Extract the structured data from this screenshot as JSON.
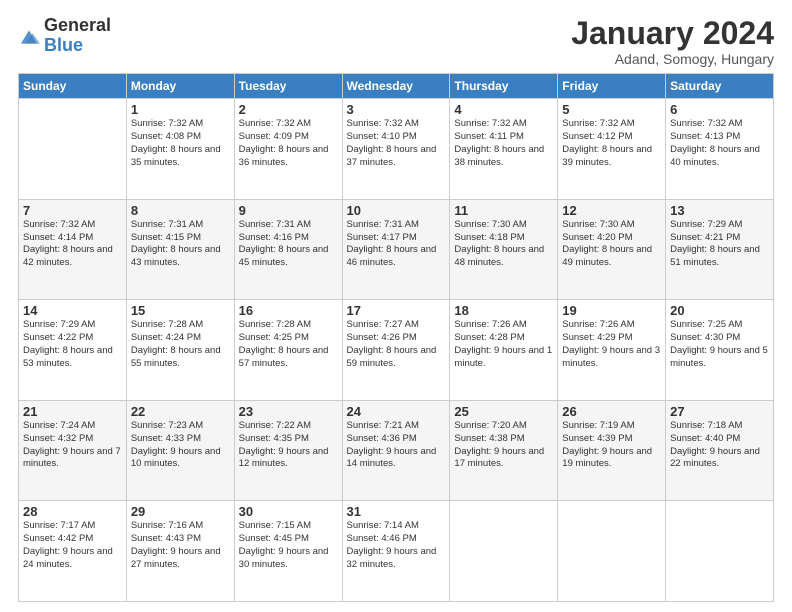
{
  "logo": {
    "general": "General",
    "blue": "Blue"
  },
  "title": "January 2024",
  "subtitle": "Adand, Somogy, Hungary",
  "days_header": [
    "Sunday",
    "Monday",
    "Tuesday",
    "Wednesday",
    "Thursday",
    "Friday",
    "Saturday"
  ],
  "weeks": [
    [
      {
        "day": "",
        "sunrise": "",
        "sunset": "",
        "daylight": ""
      },
      {
        "day": "1",
        "sunrise": "Sunrise: 7:32 AM",
        "sunset": "Sunset: 4:08 PM",
        "daylight": "Daylight: 8 hours and 35 minutes."
      },
      {
        "day": "2",
        "sunrise": "Sunrise: 7:32 AM",
        "sunset": "Sunset: 4:09 PM",
        "daylight": "Daylight: 8 hours and 36 minutes."
      },
      {
        "day": "3",
        "sunrise": "Sunrise: 7:32 AM",
        "sunset": "Sunset: 4:10 PM",
        "daylight": "Daylight: 8 hours and 37 minutes."
      },
      {
        "day": "4",
        "sunrise": "Sunrise: 7:32 AM",
        "sunset": "Sunset: 4:11 PM",
        "daylight": "Daylight: 8 hours and 38 minutes."
      },
      {
        "day": "5",
        "sunrise": "Sunrise: 7:32 AM",
        "sunset": "Sunset: 4:12 PM",
        "daylight": "Daylight: 8 hours and 39 minutes."
      },
      {
        "day": "6",
        "sunrise": "Sunrise: 7:32 AM",
        "sunset": "Sunset: 4:13 PM",
        "daylight": "Daylight: 8 hours and 40 minutes."
      }
    ],
    [
      {
        "day": "7",
        "sunrise": "Sunrise: 7:32 AM",
        "sunset": "Sunset: 4:14 PM",
        "daylight": "Daylight: 8 hours and 42 minutes."
      },
      {
        "day": "8",
        "sunrise": "Sunrise: 7:31 AM",
        "sunset": "Sunset: 4:15 PM",
        "daylight": "Daylight: 8 hours and 43 minutes."
      },
      {
        "day": "9",
        "sunrise": "Sunrise: 7:31 AM",
        "sunset": "Sunset: 4:16 PM",
        "daylight": "Daylight: 8 hours and 45 minutes."
      },
      {
        "day": "10",
        "sunrise": "Sunrise: 7:31 AM",
        "sunset": "Sunset: 4:17 PM",
        "daylight": "Daylight: 8 hours and 46 minutes."
      },
      {
        "day": "11",
        "sunrise": "Sunrise: 7:30 AM",
        "sunset": "Sunset: 4:18 PM",
        "daylight": "Daylight: 8 hours and 48 minutes."
      },
      {
        "day": "12",
        "sunrise": "Sunrise: 7:30 AM",
        "sunset": "Sunset: 4:20 PM",
        "daylight": "Daylight: 8 hours and 49 minutes."
      },
      {
        "day": "13",
        "sunrise": "Sunrise: 7:29 AM",
        "sunset": "Sunset: 4:21 PM",
        "daylight": "Daylight: 8 hours and 51 minutes."
      }
    ],
    [
      {
        "day": "14",
        "sunrise": "Sunrise: 7:29 AM",
        "sunset": "Sunset: 4:22 PM",
        "daylight": "Daylight: 8 hours and 53 minutes."
      },
      {
        "day": "15",
        "sunrise": "Sunrise: 7:28 AM",
        "sunset": "Sunset: 4:24 PM",
        "daylight": "Daylight: 8 hours and 55 minutes."
      },
      {
        "day": "16",
        "sunrise": "Sunrise: 7:28 AM",
        "sunset": "Sunset: 4:25 PM",
        "daylight": "Daylight: 8 hours and 57 minutes."
      },
      {
        "day": "17",
        "sunrise": "Sunrise: 7:27 AM",
        "sunset": "Sunset: 4:26 PM",
        "daylight": "Daylight: 8 hours and 59 minutes."
      },
      {
        "day": "18",
        "sunrise": "Sunrise: 7:26 AM",
        "sunset": "Sunset: 4:28 PM",
        "daylight": "Daylight: 9 hours and 1 minute."
      },
      {
        "day": "19",
        "sunrise": "Sunrise: 7:26 AM",
        "sunset": "Sunset: 4:29 PM",
        "daylight": "Daylight: 9 hours and 3 minutes."
      },
      {
        "day": "20",
        "sunrise": "Sunrise: 7:25 AM",
        "sunset": "Sunset: 4:30 PM",
        "daylight": "Daylight: 9 hours and 5 minutes."
      }
    ],
    [
      {
        "day": "21",
        "sunrise": "Sunrise: 7:24 AM",
        "sunset": "Sunset: 4:32 PM",
        "daylight": "Daylight: 9 hours and 7 minutes."
      },
      {
        "day": "22",
        "sunrise": "Sunrise: 7:23 AM",
        "sunset": "Sunset: 4:33 PM",
        "daylight": "Daylight: 9 hours and 10 minutes."
      },
      {
        "day": "23",
        "sunrise": "Sunrise: 7:22 AM",
        "sunset": "Sunset: 4:35 PM",
        "daylight": "Daylight: 9 hours and 12 minutes."
      },
      {
        "day": "24",
        "sunrise": "Sunrise: 7:21 AM",
        "sunset": "Sunset: 4:36 PM",
        "daylight": "Daylight: 9 hours and 14 minutes."
      },
      {
        "day": "25",
        "sunrise": "Sunrise: 7:20 AM",
        "sunset": "Sunset: 4:38 PM",
        "daylight": "Daylight: 9 hours and 17 minutes."
      },
      {
        "day": "26",
        "sunrise": "Sunrise: 7:19 AM",
        "sunset": "Sunset: 4:39 PM",
        "daylight": "Daylight: 9 hours and 19 minutes."
      },
      {
        "day": "27",
        "sunrise": "Sunrise: 7:18 AM",
        "sunset": "Sunset: 4:40 PM",
        "daylight": "Daylight: 9 hours and 22 minutes."
      }
    ],
    [
      {
        "day": "28",
        "sunrise": "Sunrise: 7:17 AM",
        "sunset": "Sunset: 4:42 PM",
        "daylight": "Daylight: 9 hours and 24 minutes."
      },
      {
        "day": "29",
        "sunrise": "Sunrise: 7:16 AM",
        "sunset": "Sunset: 4:43 PM",
        "daylight": "Daylight: 9 hours and 27 minutes."
      },
      {
        "day": "30",
        "sunrise": "Sunrise: 7:15 AM",
        "sunset": "Sunset: 4:45 PM",
        "daylight": "Daylight: 9 hours and 30 minutes."
      },
      {
        "day": "31",
        "sunrise": "Sunrise: 7:14 AM",
        "sunset": "Sunset: 4:46 PM",
        "daylight": "Daylight: 9 hours and 32 minutes."
      },
      {
        "day": "",
        "sunrise": "",
        "sunset": "",
        "daylight": ""
      },
      {
        "day": "",
        "sunrise": "",
        "sunset": "",
        "daylight": ""
      },
      {
        "day": "",
        "sunrise": "",
        "sunset": "",
        "daylight": ""
      }
    ]
  ]
}
